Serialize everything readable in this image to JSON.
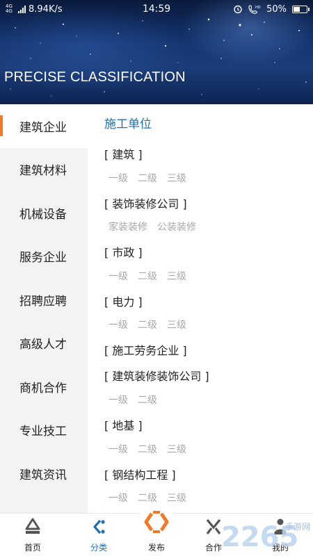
{
  "status_bar": {
    "network": "4G 4G",
    "speed": "8.94K/s",
    "time": "14:59",
    "battery": "50%",
    "battery_level": 0.5
  },
  "hero": {
    "title": "PRECISE CLASSIFICATION"
  },
  "sidebar": {
    "items": [
      {
        "label": "建筑企业",
        "active": true
      },
      {
        "label": "建筑材料",
        "active": false
      },
      {
        "label": "机械设备",
        "active": false
      },
      {
        "label": "服务企业",
        "active": false
      },
      {
        "label": "招聘应聘",
        "active": false
      },
      {
        "label": "高级人才",
        "active": false
      },
      {
        "label": "商机合作",
        "active": false
      },
      {
        "label": "专业技工",
        "active": false
      },
      {
        "label": "建筑资讯",
        "active": false
      }
    ]
  },
  "content": {
    "section_title": "施工单位",
    "groups": [
      {
        "name": "[ 建筑 ]",
        "subs": [
          "一级",
          "二级",
          "三级"
        ]
      },
      {
        "name": "[ 装饰装修公司 ]",
        "subs": [
          "家装装修",
          "公装装修"
        ]
      },
      {
        "name": "[ 市政 ]",
        "subs": [
          "一级",
          "二级",
          "三级"
        ]
      },
      {
        "name": "[ 电力 ]",
        "subs": [
          "一级",
          "二级",
          "三级"
        ]
      },
      {
        "name": "[ 施工劳务企业 ]",
        "subs": []
      },
      {
        "name": "[ 建筑装修装饰公司 ]",
        "subs": [
          "一级",
          "二级"
        ]
      },
      {
        "name": "[ 地基 ]",
        "subs": [
          "一级",
          "二级",
          "三级"
        ]
      },
      {
        "name": "[ 钢结构工程 ]",
        "subs": [
          "一级",
          "二级",
          "三级"
        ]
      }
    ]
  },
  "bottom_nav": {
    "items": [
      {
        "label": "首页",
        "icon": "home-icon"
      },
      {
        "label": "分类",
        "icon": "category-icon",
        "active": true
      },
      {
        "label": "发布",
        "icon": "publish-icon"
      },
      {
        "label": "合作",
        "icon": "cooperation-icon"
      },
      {
        "label": "我的",
        "icon": "profile-icon"
      }
    ]
  },
  "colors": {
    "accent_blue": "#1f6fb0",
    "accent_orange": "#f07a28",
    "sidebar_bg": "#f3f3f3"
  },
  "watermark": {
    "text": "2265",
    "sub": "手游网"
  }
}
